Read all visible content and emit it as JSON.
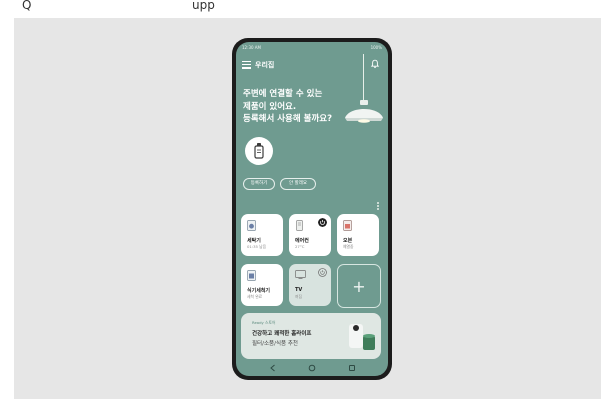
{
  "top_strip": {
    "left_text": "Q",
    "right_text": "upp"
  },
  "status_bar": {
    "time": "12:30 AM",
    "battery": "100%"
  },
  "header": {
    "title": "우리집"
  },
  "promo": {
    "lines": [
      "주변에 연결할 수 있는",
      "제품이 있어요.",
      "등록해서 사용해 볼까요?"
    ]
  },
  "actions": {
    "register_label": "등록하기",
    "later_label": "안 할래요"
  },
  "devices": [
    {
      "name": "세탁기",
      "status": "01:35 남음",
      "icon": "washer-icon",
      "power": "on"
    },
    {
      "name": "에어컨",
      "status": "27°C",
      "icon": "air-conditioner-icon",
      "power": "on-dark"
    },
    {
      "name": "오븐",
      "status": "예열중",
      "icon": "oven-icon",
      "power": "on"
    },
    {
      "name": "식기세척기",
      "status": "세척 완료",
      "icon": "dishwasher-icon",
      "power": "none"
    },
    {
      "name": "TV",
      "status": "꺼짐",
      "icon": "tv-icon",
      "power": "off"
    }
  ],
  "add_device": {
    "label": "+"
  },
  "banner": {
    "tag": "Ready 스토어",
    "title": "건강하고 쾌적한 홈라이프",
    "subtitle": "필터/소품/식품 추천"
  },
  "colors": {
    "screen_bg": "#6f9b90",
    "card_bg": "#ffffff",
    "card_off_bg": "#d8e3df",
    "accent": "#5a8a7d"
  }
}
